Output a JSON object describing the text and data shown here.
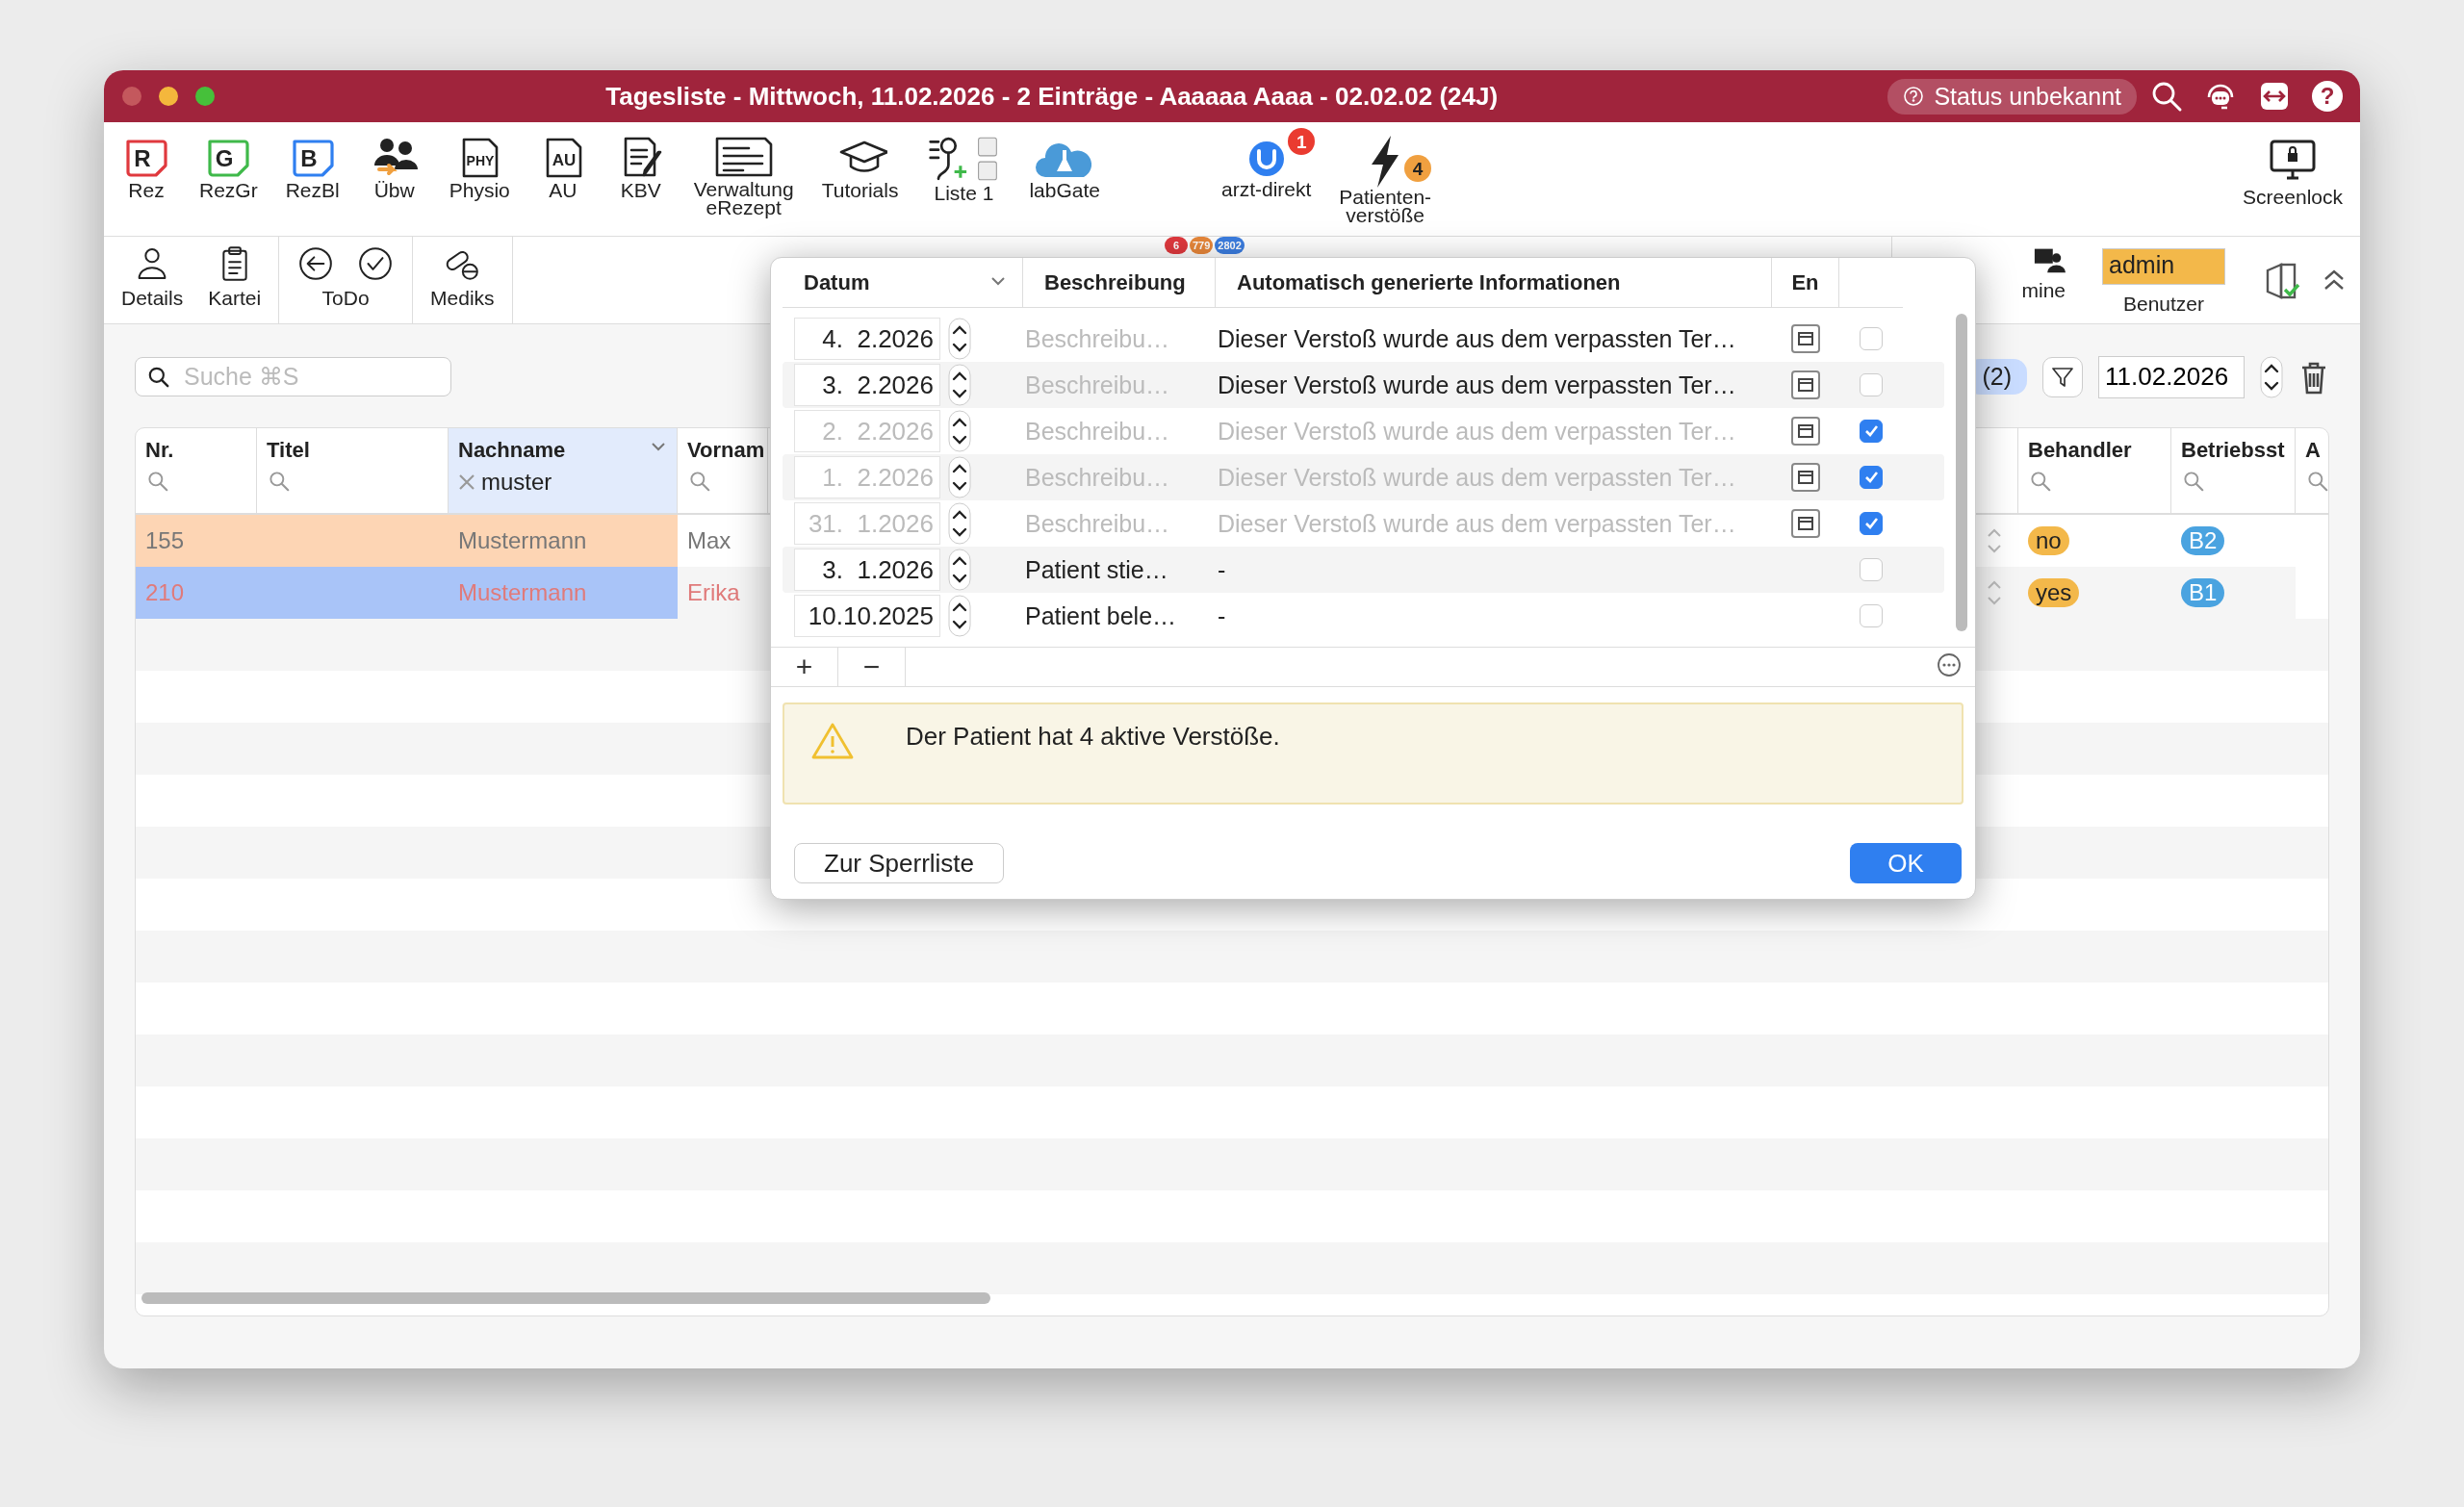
{
  "window": {
    "title": "Tagesliste - Mittwoch, 11.02.2026 - 2 Einträge - Aaaaaa Aaaa - 02.02.02 (24J)",
    "status": "Status unbekannt",
    "help": "?"
  },
  "toolbar": [
    {
      "label": "Rez",
      "glyph": "R",
      "color": "#e0393e"
    },
    {
      "label": "RezGr",
      "glyph": "G",
      "color": "#3fb94a"
    },
    {
      "label": "RezBl",
      "glyph": "B",
      "color": "#2f7ff0"
    },
    {
      "label": "Übw"
    },
    {
      "label": "Physio",
      "glyph": "PHY"
    },
    {
      "label": "AU",
      "glyph": "AU"
    },
    {
      "label": "KBV"
    },
    {
      "label": "Verwaltung\neRezept"
    },
    {
      "label": "Tutorials"
    },
    {
      "label": "Liste 1"
    },
    {
      "label": "labGate"
    }
  ],
  "toolbar_center": [
    {
      "label": "arzt-direkt",
      "badge": {
        "text": "1",
        "color": "#ea3b30"
      }
    },
    {
      "label": "Patienten-\nverstöße",
      "badge": {
        "text": "4",
        "color": "#f0a040"
      }
    }
  ],
  "screenlock": {
    "label": "Screenlock"
  },
  "counters": [
    {
      "text": "6",
      "color": "#e0393e"
    },
    {
      "text": "779",
      "color": "#e8873a"
    },
    {
      "text": "2802",
      "color": "#3b7de0"
    }
  ],
  "toolbar2": [
    {
      "label": "Details"
    },
    {
      "label": "Kartei"
    },
    {
      "label": "ToDo"
    },
    {
      "label": "Mediks"
    }
  ],
  "termine": {
    "label": "mine"
  },
  "user": {
    "value": "admin",
    "label": "Benutzer"
  },
  "search": {
    "placeholder": "Suche ⌘S"
  },
  "filter_pill": "(2)",
  "date": "11.02.2026",
  "table": {
    "columns": [
      {
        "label": "Nr."
      },
      {
        "label": "Titel"
      },
      {
        "label": "Nachname",
        "sorted": true,
        "filter": "muster"
      },
      {
        "label": "Vornam"
      },
      {
        "label": "Behandler"
      },
      {
        "label": "Betriebsst"
      },
      {
        "label": "A"
      }
    ],
    "rows": [
      {
        "nr": "155",
        "nachname": "Mustermann",
        "vorname": "Max",
        "behandler": "no",
        "betriebsstaette": "B2",
        "color": "#fdd5b4",
        "selected": false
      },
      {
        "nr": "210",
        "nachname": "Mustermann",
        "vorname": "Erika",
        "behandler": "yes",
        "betriebsstaette": "B1",
        "selected": true
      }
    ]
  },
  "popover": {
    "columns": [
      "Datum",
      "Beschreibung",
      "Automatisch generierte Informationen",
      "En"
    ],
    "rows": [
      {
        "date": "4.  2.2026",
        "placeholder": "Beschreibu…",
        "info": "Dieser Verstoß wurde aus dem verpassten Ter…",
        "kind": "auto",
        "checked": false
      },
      {
        "date": "3.  2.2026",
        "placeholder": "Beschreibu…",
        "info": "Dieser Verstoß wurde aus dem verpassten Ter…",
        "kind": "auto",
        "checked": false
      },
      {
        "date": "2.  2.2026",
        "placeholder": "Beschreibu…",
        "info": "Dieser Verstoß wurde aus dem verpassten Ter…",
        "kind": "auto",
        "checked": true
      },
      {
        "date": "1.  2.2026",
        "placeholder": "Beschreibu…",
        "info": "Dieser Verstoß wurde aus dem verpassten Ter…",
        "kind": "auto",
        "checked": true
      },
      {
        "date": "31.  1.2026",
        "placeholder": "Beschreibu…",
        "info": "Dieser Verstoß wurde aus dem verpassten Ter…",
        "kind": "auto",
        "checked": true
      },
      {
        "date": "3.  1.2026",
        "description": "Patient stie…",
        "info": "-",
        "kind": "manual",
        "checked": false
      },
      {
        "date": "10.10.2025",
        "description": "Patient bele…",
        "info": "-",
        "kind": "manual",
        "checked": false
      }
    ],
    "add": "+",
    "remove": "−",
    "alert": "Der Patient hat 4 aktive Verstöße.",
    "buttons": [
      {
        "label": "Zur Sperrliste",
        "kind": "secondary"
      },
      {
        "label": "OK",
        "kind": "primary"
      }
    ]
  }
}
